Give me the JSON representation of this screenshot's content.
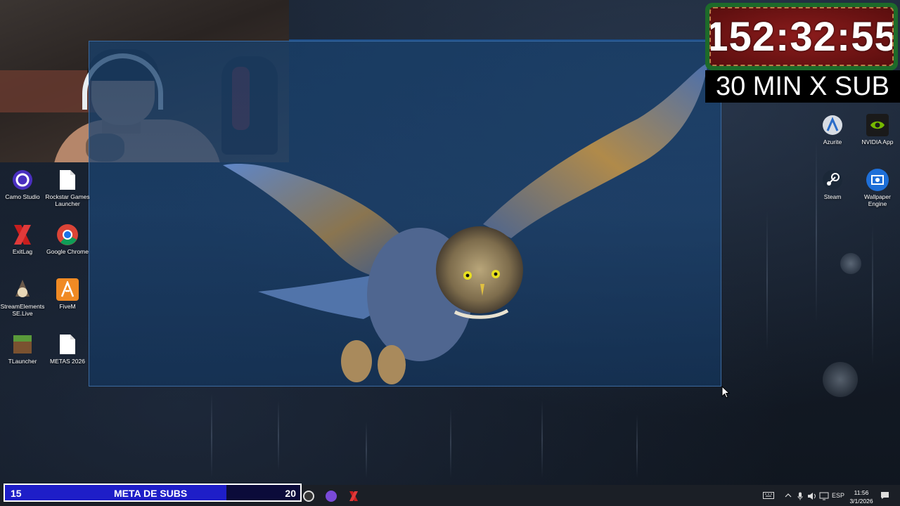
{
  "overlay": {
    "timer": "152:32:55",
    "banner": "30 MIN X SUB"
  },
  "desktop_icons_left": [
    {
      "label": "Camo Studio",
      "icon": "camo-studio-icon",
      "color": "#4a2fbf"
    },
    {
      "label": "Rockstar Games Launcher",
      "icon": "document-icon",
      "color": "#ffffff"
    },
    {
      "label": "ExitLag",
      "icon": "exitlag-icon",
      "color": "#c81e1e"
    },
    {
      "label": "Google Chrome",
      "icon": "chrome-icon",
      "color": "#1a73e8"
    },
    {
      "label": "StreamElements SE.Live",
      "icon": "streamelements-icon",
      "color": "#6b5a4a"
    },
    {
      "label": "FiveM",
      "icon": "fivem-icon",
      "color": "#f08a24"
    },
    {
      "label": "TLauncher",
      "icon": "minecraft-icon",
      "color": "#5a9a3a"
    },
    {
      "label": "METAS 2026",
      "icon": "document-icon",
      "color": "#ffffff"
    }
  ],
  "desktop_icons_right": [
    {
      "label": "Azurite",
      "icon": "azurite-icon",
      "color": "#d8dde4"
    },
    {
      "label": "NVIDIA App",
      "icon": "nvidia-icon",
      "color": "#76b900"
    },
    {
      "label": "Steam",
      "icon": "steam-icon",
      "color": "#1b2838"
    },
    {
      "label": "Wallpaper Engine",
      "icon": "wallpaper-engine-icon",
      "color": "#1e6fd8"
    }
  ],
  "subs_bar": {
    "current": "15",
    "label": "META DE SUBS",
    "goal": "20",
    "progress": 0.75,
    "fill_color": "#1e1ec8"
  },
  "tray": {
    "language": "ESP",
    "time": "11:56",
    "date": "3/1/2026"
  }
}
